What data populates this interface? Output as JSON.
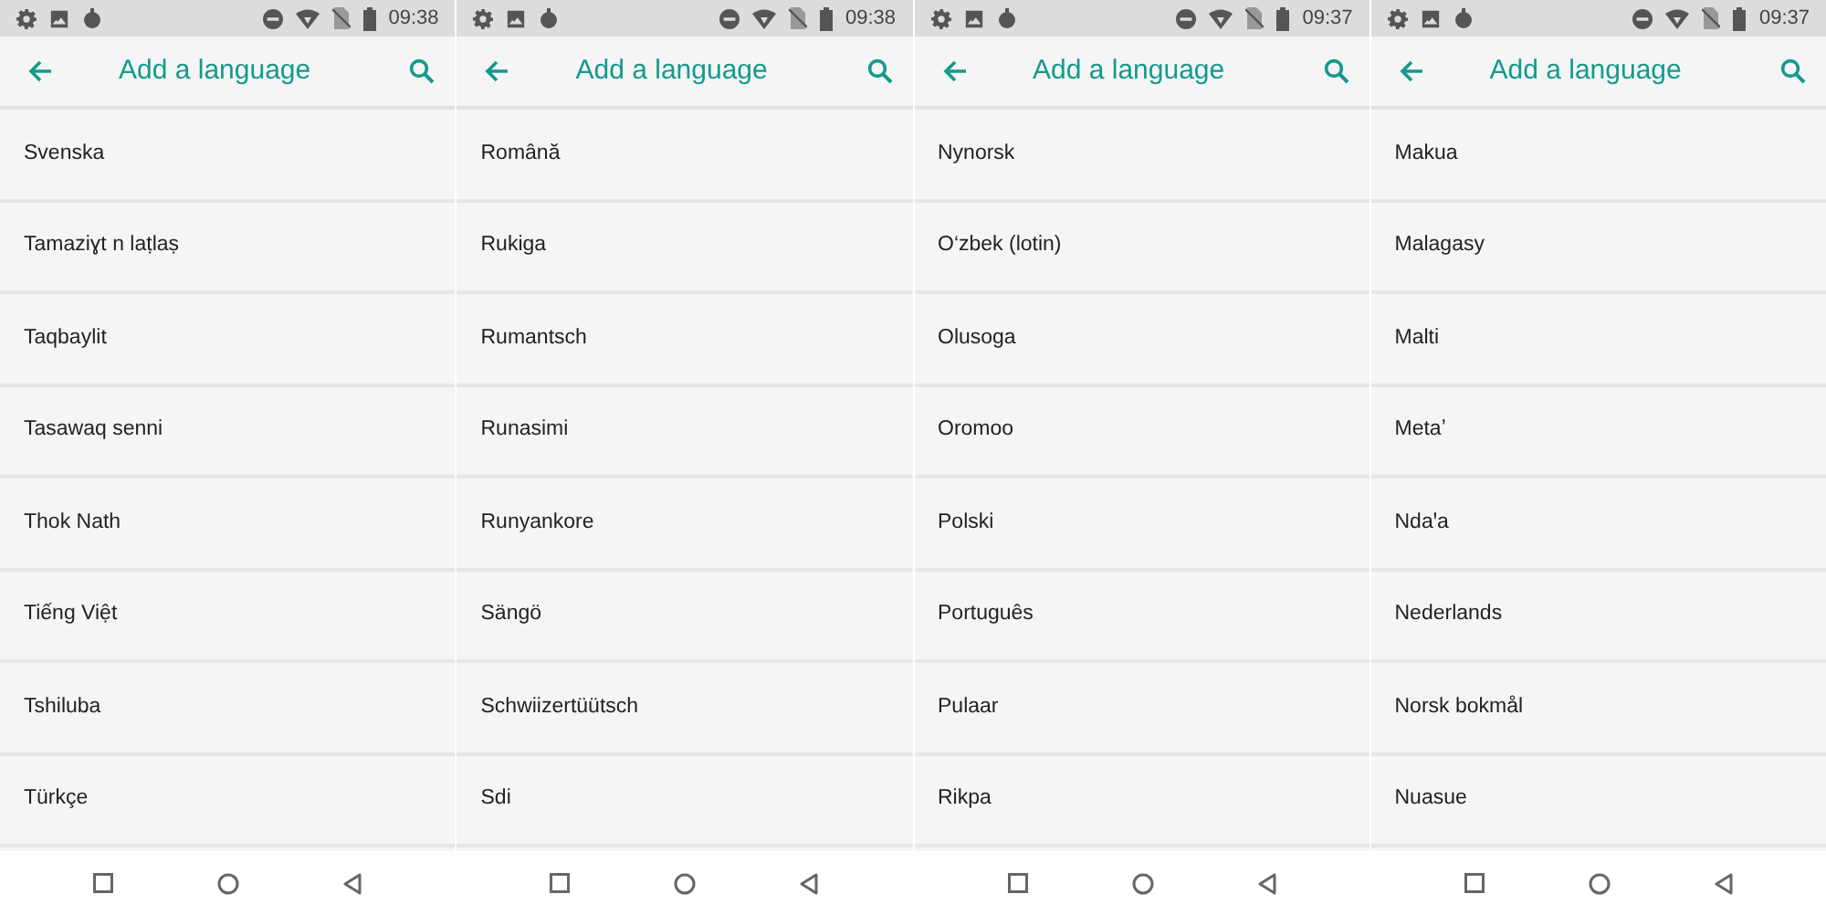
{
  "screens": [
    {
      "status_bar": {
        "time": "09:38"
      },
      "toolbar": {
        "title": "Add a language"
      },
      "items": [
        "Svenska",
        "Tamaziɣt n laṭlaṣ",
        "Taqbaylit",
        "Tasawaq senni",
        "Thok Nath",
        "Tiếng Việt",
        "Tshiluba",
        "Türkçe"
      ]
    },
    {
      "status_bar": {
        "time": "09:38"
      },
      "toolbar": {
        "title": "Add a language"
      },
      "items": [
        "Română",
        "Rukiga",
        "Rumantsch",
        "Runasimi",
        "Runyankore",
        "Sängö",
        "Schwiizertüütsch",
        "Sdi"
      ]
    },
    {
      "status_bar": {
        "time": "09:37"
      },
      "toolbar": {
        "title": "Add a language"
      },
      "items": [
        "Nynorsk",
        "O‘zbek (lotin)",
        "Olusoga",
        "Oromoo",
        "Polski",
        "Português",
        "Pulaar",
        "Rikpa"
      ]
    },
    {
      "status_bar": {
        "time": "09:37"
      },
      "toolbar": {
        "title": "Add a language"
      },
      "items": [
        "Makua",
        "Malagasy",
        "Malti",
        "Metaʼ",
        "Ndaꞌa",
        "Nederlands",
        "Norsk bokmål",
        "Nuasue"
      ]
    }
  ]
}
